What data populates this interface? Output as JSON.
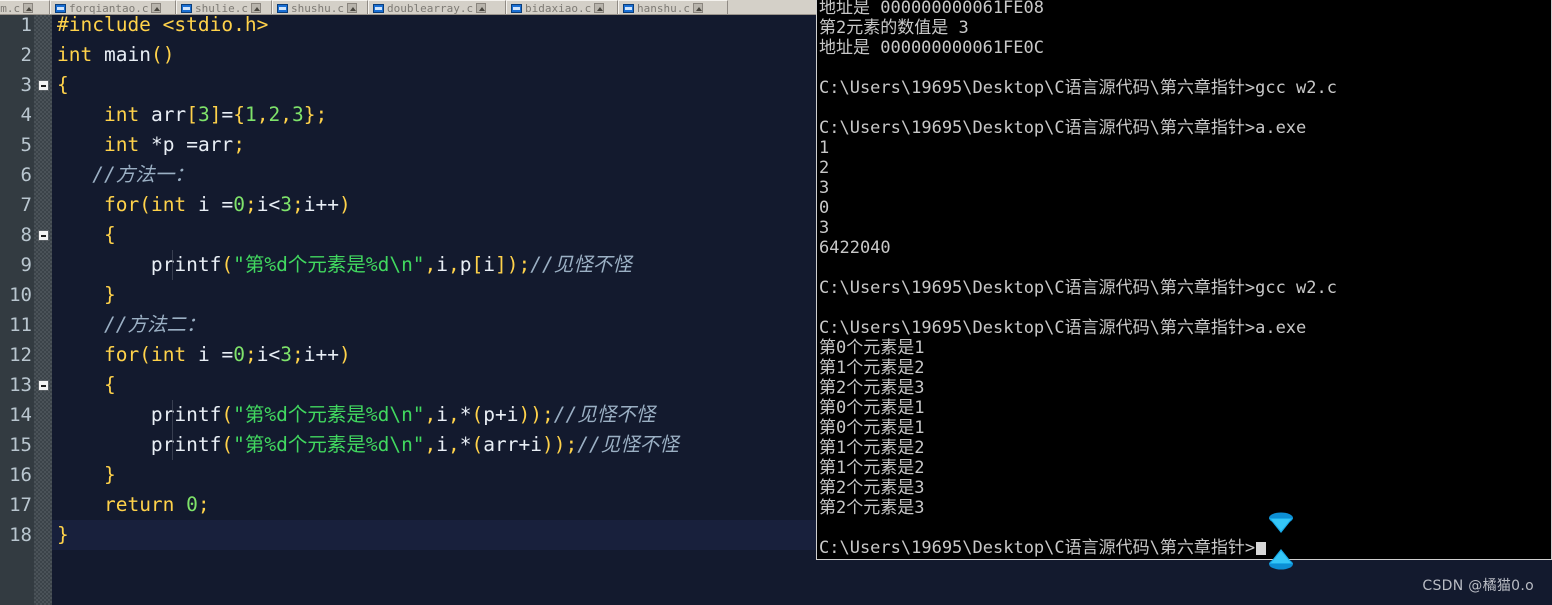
{
  "tabs": [
    {
      "label": "sum.c",
      "icon": "file-c-icon",
      "close": "close-icon"
    },
    {
      "label": "forqiantao.c",
      "icon": "file-c-icon",
      "close": "close-icon"
    },
    {
      "label": "shulie.c",
      "icon": "file-c-icon",
      "close": "close-icon"
    },
    {
      "label": "shushu.c",
      "icon": "file-c-icon",
      "close": "close-icon"
    },
    {
      "label": "doublearray.c",
      "icon": "file-c-icon",
      "close": "close-icon"
    },
    {
      "label": "bidaxiao.c",
      "icon": "file-c-icon",
      "close": "close-icon"
    },
    {
      "label": "hanshu.c",
      "icon": "file-c-icon",
      "close": "close-icon"
    }
  ],
  "editor": {
    "language": "c",
    "current_line": 18,
    "fold_markers": [
      3,
      8,
      13
    ],
    "line_numbers": [
      1,
      2,
      3,
      4,
      5,
      6,
      7,
      8,
      9,
      10,
      11,
      12,
      13,
      14,
      15,
      16,
      17,
      18
    ],
    "lines": [
      {
        "n": 1,
        "text": "#include <stdio.h>"
      },
      {
        "n": 2,
        "text": "int main()"
      },
      {
        "n": 3,
        "text": "{"
      },
      {
        "n": 4,
        "text": "    int arr[3]={1,2,3};"
      },
      {
        "n": 5,
        "text": "    int *p =arr;"
      },
      {
        "n": 6,
        "text": "   //方法一："
      },
      {
        "n": 7,
        "text": "    for(int i =0;i<3;i++)"
      },
      {
        "n": 8,
        "text": "    {"
      },
      {
        "n": 9,
        "text": "        printf(\"第%d个元素是%d\\n\",i,p[i]);//见怪不怪"
      },
      {
        "n": 10,
        "text": "    }"
      },
      {
        "n": 11,
        "text": "    //方法二："
      },
      {
        "n": 12,
        "text": "    for(int i =0;i<3;i++)"
      },
      {
        "n": 13,
        "text": "    {"
      },
      {
        "n": 14,
        "text": "        printf(\"第%d个元素是%d\\n\",i,*(p+i));//见怪不怪"
      },
      {
        "n": 15,
        "text": "        printf(\"第%d个元素是%d\\n\",i,*(arr+i));//见怪不怪"
      },
      {
        "n": 16,
        "text": "    }"
      },
      {
        "n": 17,
        "text": "    return 0;"
      },
      {
        "n": 18,
        "text": "}"
      }
    ]
  },
  "terminal": {
    "prompt_path": "C:\\Users\\19695\\Desktop\\C语言源代码\\第六章指针>",
    "lines": [
      "地址是 000000000061FE08",
      "第2元素的数值是 3",
      "地址是 000000000061FE0C",
      "",
      "C:\\Users\\19695\\Desktop\\C语言源代码\\第六章指针>gcc w2.c",
      "",
      "C:\\Users\\19695\\Desktop\\C语言源代码\\第六章指针>a.exe",
      "1",
      "2",
      "3",
      "0",
      "3",
      "6422040",
      "",
      "C:\\Users\\19695\\Desktop\\C语言源代码\\第六章指针>gcc w2.c",
      "",
      "C:\\Users\\19695\\Desktop\\C语言源代码\\第六章指针>a.exe",
      "第0个元素是1",
      "第1个元素是2",
      "第2个元素是3",
      "第0个元素是1",
      "第0个元素是1",
      "第1个元素是2",
      "第1个元素是2",
      "第2个元素是3",
      "第2个元素是3",
      "",
      "C:\\Users\\19695\\Desktop\\C语言源代码\\第六章指针>"
    ]
  },
  "cursor": {
    "icon": "busy-hourglass-cursor"
  },
  "watermark": {
    "text": "CSDN @橘猫0.o"
  },
  "colors": {
    "editor_bg": "#131a2e",
    "gutter_bg": "#333b41",
    "current_line_bg": "#18203c",
    "keyword": "#ffd24a",
    "string": "#41d85f",
    "number": "#7fe36a",
    "comment": "#9bb0c4",
    "identifier": "#e8eef5",
    "terminal_bg": "#000000",
    "terminal_fg": "#c8c8c8",
    "tabbar_bg": "#d4d0c8"
  }
}
